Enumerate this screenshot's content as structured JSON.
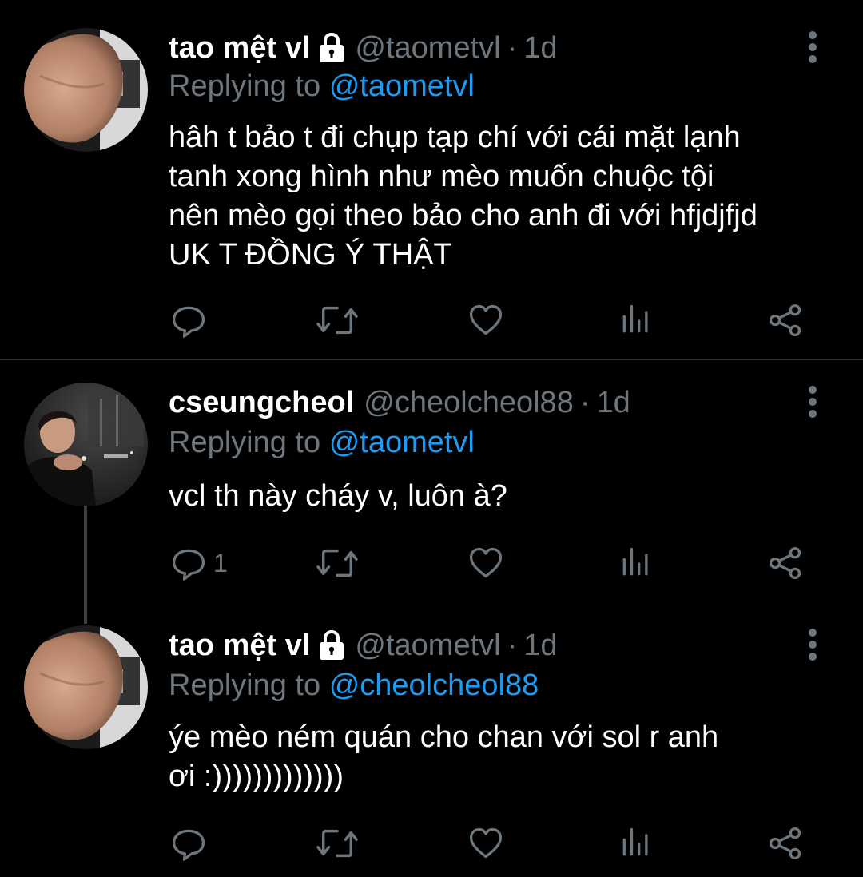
{
  "colors": {
    "background": "#000000",
    "text": "#ffffff",
    "secondary": "#6e767d",
    "accent": "#1d9bf0",
    "separator": "#2f3336"
  },
  "tweets": [
    {
      "name": "tao mệt vl",
      "locked": true,
      "handle": "@taometvl",
      "separator": "·",
      "time": "1d",
      "replying_prefix": "Replying to",
      "replying_to": "@taometvl",
      "text_lines": [
        "hâh t bảo t đi chụp tạp chí với cái mặt lạnh",
        "tanh xong hình như mèo muốn chuộc tội",
        "nên mèo gọi theo bảo cho anh đi với hfjdjfjd",
        "UK T ĐỒNG Ý THẬT"
      ],
      "reply_count": "",
      "icons": [
        "reply-icon",
        "retweet-icon",
        "like-icon",
        "analytics-icon",
        "share-icon"
      ]
    },
    {
      "name": "cseungcheol",
      "locked": false,
      "handle": "@cheolcheol88",
      "separator": "·",
      "time": "1d",
      "replying_prefix": "Replying to",
      "replying_to": "@taometvl",
      "text_lines": [
        "vcl th này cháy v, luôn à?"
      ],
      "reply_count": "1",
      "icons": [
        "reply-icon",
        "retweet-icon",
        "like-icon",
        "analytics-icon",
        "share-icon"
      ]
    },
    {
      "name": "tao mệt vl",
      "locked": true,
      "handle": "@taometvl",
      "separator": "·",
      "time": "1d",
      "replying_prefix": "Replying to",
      "replying_to": "@cheolcheol88",
      "text_lines": [
        "ýe mèo ném quán cho chan với sol r anh",
        "ơi :)))))))))))))"
      ],
      "reply_count": "",
      "icons": [
        "reply-icon",
        "retweet-icon",
        "like-icon",
        "analytics-icon",
        "share-icon"
      ]
    }
  ]
}
